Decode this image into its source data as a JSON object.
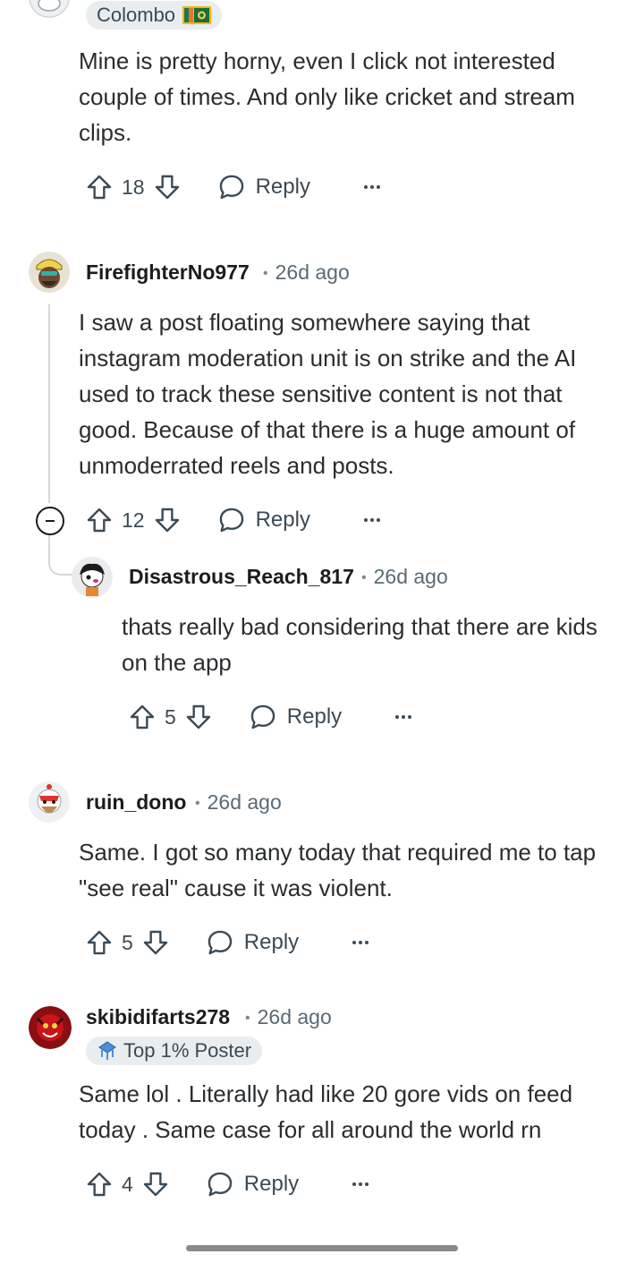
{
  "colors": {
    "text": "#1c1c1c",
    "meta": "#5a6a75",
    "action": "#3c4a55",
    "flair_bg": "#e9edf0",
    "thread_line": "#d4d8db"
  },
  "comments": [
    {
      "flair": "Colombo",
      "flair_icon": "sri-lanka-flag-icon",
      "body": "Mine is pretty horny, even I click not interested couple of times. And only like cricket and stream clips.",
      "score": "18",
      "reply_label": "Reply"
    },
    {
      "username": "FirefighterNo977",
      "time": "26d ago",
      "body": "I saw a post floating somewhere saying that instagram moderation unit is on strike and the AI used to track these sensitive content is not that good. Because of that there is a huge amount of unmoderrated reels and posts.",
      "score": "12",
      "reply_label": "Reply"
    },
    {
      "username": "Disastrous_Reach_817",
      "time": "26d ago",
      "body": "thats really bad considering that there are kids on the app",
      "score": "5",
      "reply_label": "Reply"
    },
    {
      "username": "ruin_dono",
      "time": "26d ago",
      "body": "Same. I got so many today that required me to tap \"see real\" cause it was violent.",
      "score": "5",
      "reply_label": "Reply"
    },
    {
      "username": "skibidifarts278",
      "time": "26d ago",
      "flair": "Top 1% Poster",
      "flair_icon": "top-poster-icon",
      "body": "Same lol . Literally had like 20 gore vids on feed today . Same case for all around the world rn",
      "score": "4",
      "reply_label": "Reply"
    }
  ]
}
